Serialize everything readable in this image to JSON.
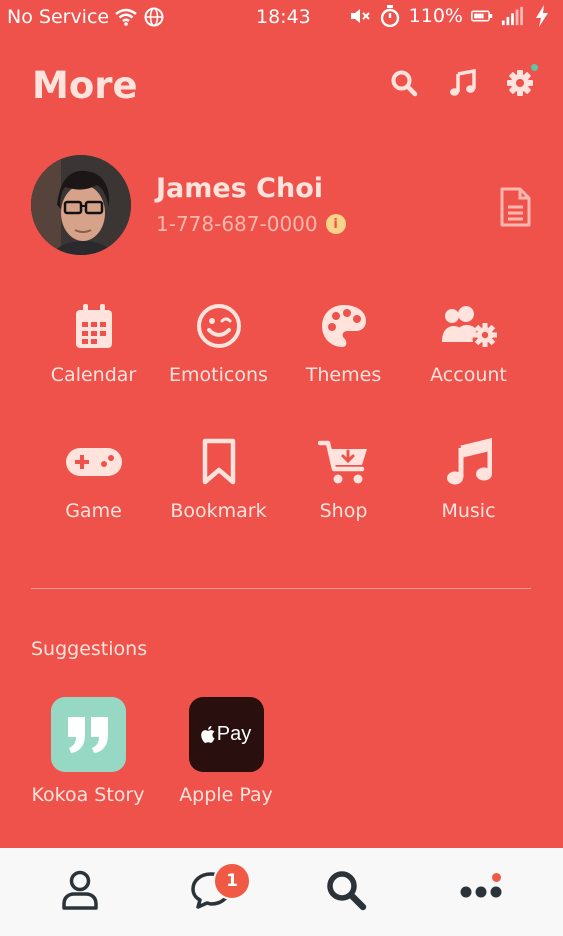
{
  "status_bar": {
    "carrier": "No Service",
    "time": "18:43",
    "battery": "110%"
  },
  "header": {
    "title": "More"
  },
  "profile": {
    "name": "James Choi",
    "phone": "1-778-687-0000"
  },
  "menu": [
    {
      "label": "Calendar"
    },
    {
      "label": "Emoticons"
    },
    {
      "label": "Themes"
    },
    {
      "label": "Account"
    },
    {
      "label": "Game"
    },
    {
      "label": "Bookmark"
    },
    {
      "label": "Shop"
    },
    {
      "label": "Music"
    }
  ],
  "suggestions": {
    "title": "Suggestions",
    "items": [
      {
        "label": "Kokoa Story",
        "tile_text": ""
      },
      {
        "label": "Apple Pay",
        "tile_text": "Pay"
      }
    ]
  },
  "tabbar": {
    "chats_badge": "1"
  },
  "colors": {
    "background": "#EF524B",
    "tabbar": "#F8F8F8",
    "kokoa_tile": "#97D8C4",
    "applepay_tile": "#2A0F0F",
    "badge": "#F05A45"
  }
}
